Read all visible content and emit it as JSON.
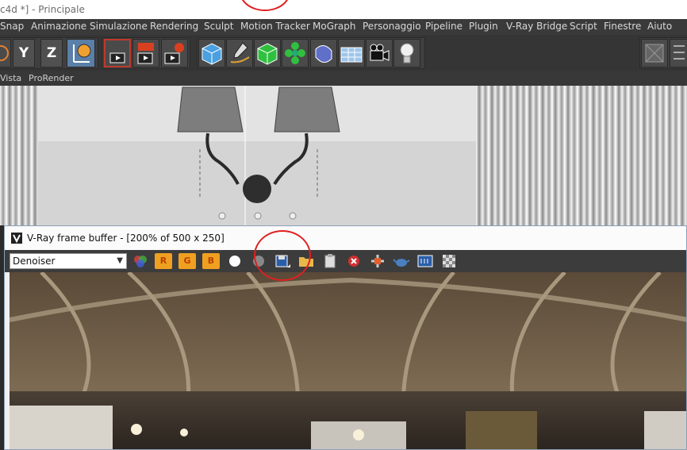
{
  "window": {
    "title": "c4d *] - Principale"
  },
  "menubar": {
    "items": [
      "Snap",
      "Animazione",
      "Simulazione",
      "Rendering",
      "Sculpt",
      "Motion Tracker",
      "MoGraph",
      "Personaggio",
      "Pipeline",
      "Plugin",
      "V-Ray Bridge",
      "Script",
      "Finestre",
      "Aiuto"
    ]
  },
  "toolbar": {
    "axis_y": "Y",
    "axis_z": "Z",
    "icons": [
      "world-axis-icon",
      "render-view-icon",
      "render-picture-viewer-icon",
      "render-settings-icon",
      "cube-icon",
      "pen-spline-icon",
      "subdivision-icon",
      "cloner-icon",
      "deformer-icon",
      "floor-icon",
      "camera-icon",
      "light-icon"
    ]
  },
  "viewport_menu": {
    "items": [
      "Vista",
      "ProRender"
    ]
  },
  "vfb": {
    "title": "V-Ray frame buffer - [200% of 500 x 250]",
    "channel": "Denoiser",
    "buttons": {
      "r": "R",
      "g": "G",
      "b": "B"
    },
    "icons": [
      "color-channels-icon",
      "white-circle-icon",
      "gray-sphere-icon",
      "save-image-icon",
      "open-folder-icon",
      "clipboard-icon",
      "clear-image-icon",
      "track-mouse-icon",
      "teapot-icon",
      "lens-effects-icon",
      "checker-icon"
    ]
  },
  "colors": {
    "menubar_bg": "#3a3a3a",
    "toolbar_bg": "#353535",
    "annotation_red": "#e02020",
    "rgb_button": "#f0a020"
  }
}
